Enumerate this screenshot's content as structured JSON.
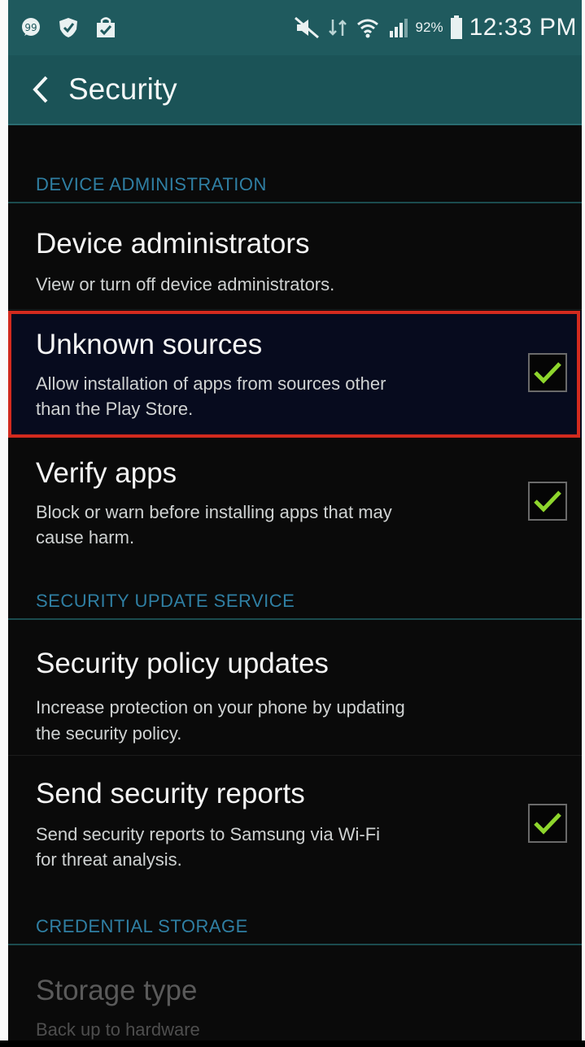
{
  "status_bar": {
    "battery": "92%",
    "time": "12:33 PM",
    "icons": [
      "chat-icon",
      "shield-icon",
      "shopping-bag-icon",
      "mute-icon",
      "data-icon",
      "wifi-icon",
      "signal-icon",
      "battery-icon"
    ]
  },
  "action_bar": {
    "title": "Security"
  },
  "sections": [
    {
      "label": "DEVICE ADMINISTRATION"
    },
    {
      "label": "SECURITY UPDATE SERVICE"
    },
    {
      "label": "CREDENTIAL STORAGE"
    }
  ],
  "items": [
    {
      "title": "Device administrators",
      "summary": "View or turn off device administrators."
    },
    {
      "title": "Unknown sources",
      "summary_line1": "Allow installation of apps from sources other",
      "summary_line2": "than the Play Store.",
      "checked": true,
      "highlighted": true
    },
    {
      "title": "Verify apps",
      "summary_line1": "Block or warn before installing apps that may",
      "summary_line2": "cause harm.",
      "checked": true
    },
    {
      "title": "Security policy updates",
      "summary_line1": "Increase protection on your phone by updating",
      "summary_line2": "the security policy."
    },
    {
      "title": "Send security reports",
      "summary_line1": "Send security reports to Samsung via Wi-Fi",
      "summary_line2": "for threat analysis.",
      "checked": true
    },
    {
      "title": "Storage type",
      "summary": "Back up to hardware",
      "disabled": true
    }
  ],
  "colors": {
    "accent": "#2f7fa3",
    "check": "#8ed62c",
    "highlight": "#d22a1e",
    "bar": "#1f5a5e"
  }
}
